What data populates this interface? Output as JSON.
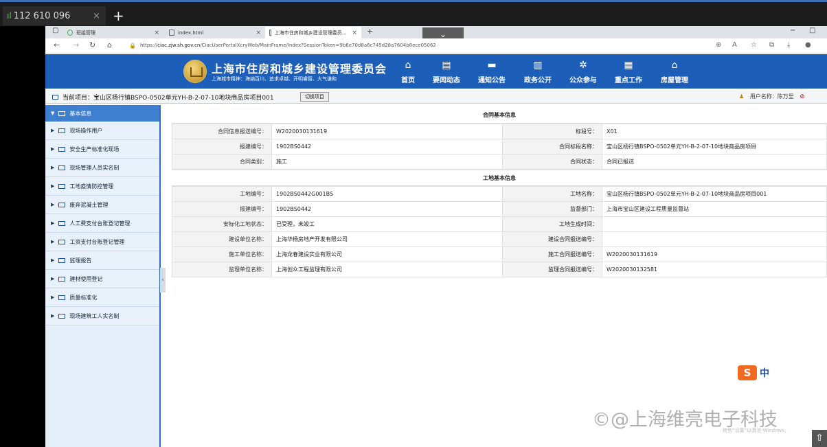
{
  "outer": {
    "tab_label": "112 610 096",
    "tab_signal": "ıl",
    "close": "×",
    "plus": "+"
  },
  "browser": {
    "tabs": [
      {
        "label": "班组管理",
        "close": "×"
      },
      {
        "label": "index.html",
        "close": "×"
      },
      {
        "label": "上海市住房和城乡建设管理委员...",
        "close": "×"
      }
    ],
    "new_tab": "+",
    "window_controls": {
      "minimize": "−",
      "maximize": "□"
    },
    "dropdown": "⌄",
    "nav": {
      "back": "←",
      "forward": "→",
      "reload": "↻",
      "home": "⌂"
    },
    "url_prefix": "https://",
    "url_domain": "ciac.zjw.sh.gov.cn",
    "url_path": "/CiacUserPortalXcryWeb/MainFrame/Index?SessionToken=9b6e70d8a6c745d28a7604b8ece05062"
  },
  "site": {
    "title": "上海市住房和城乡建设管理委员会",
    "subtitle": "上海城市精神：海纳百川、追求卓越、开明睿智、大气谦和",
    "nav": [
      {
        "label": "首页",
        "icon": "⌂"
      },
      {
        "label": "要闻动态",
        "icon": "▤"
      },
      {
        "label": "通知公告",
        "icon": "▬"
      },
      {
        "label": "政务公开",
        "icon": "▥"
      },
      {
        "label": "公众参与",
        "icon": "✲"
      },
      {
        "label": "重点工作",
        "icon": "▦"
      },
      {
        "label": "房屋管理",
        "icon": "⌂"
      }
    ]
  },
  "project": {
    "label": "当前项目：宝山区杨行镇BSPO-0502单元YH-B-2-07-10地块商品房项目001",
    "switch_button": "切换项目",
    "user_label": "用户名称：陈万里",
    "user_icon": "♟",
    "logout_icon": "⊘"
  },
  "sidebar": {
    "header": "基本信息",
    "items": [
      "现场操作用户",
      "安全生产标准化现场",
      "现场管理人员实名制",
      "工地疫情防控管理",
      "废弃泥凝土管理",
      "人工费支付台账登记管理",
      "工资支付台账登记管理",
      "监理报告",
      "建材使用登记",
      "质量标准化",
      "现场建筑工人实名制"
    ],
    "collapse": "‹"
  },
  "contract": {
    "title": "合同基本信息",
    "rows": [
      {
        "k1": "合同信息报送编号：",
        "v1": "W2020030131619",
        "k2": "标段号：",
        "v2": "X01"
      },
      {
        "k1": "报建编号：",
        "v1": "1902BS0442",
        "k2": "合同标段名称：",
        "v2": "宝山区杨行镇BSPO-0502单元YH-B-2-07-10地块商品房项目"
      },
      {
        "k1": "合同类别：",
        "v1": "施工",
        "k2": "合同状态：",
        "v2": "合同已报送"
      }
    ]
  },
  "site_info": {
    "title": "工地基本信息",
    "rows": [
      {
        "k1": "工地编号：",
        "v1": "1902BS0442G001BS",
        "k2": "工地名称：",
        "v2": "宝山区杨行镇BSPO-0502单元YH-B-2-07-10地块商品房项目001"
      },
      {
        "k1": "报建编号：",
        "v1": "1902BS0442",
        "k2": "监督部门：",
        "v2": "上海市宝山区建设工程质量监督站"
      },
      {
        "k1": "安标化工地状态：",
        "v1": "已受理，未竣工",
        "k2": "工地生成时间：",
        "v2": ""
      },
      {
        "k1": "建设单位名称：",
        "v1": "上海华杨房地产开发有限公司",
        "k2": "建设合同报送编号：",
        "v2": ""
      },
      {
        "k1": "施工单位名称：",
        "v1": "上海龙春建设实业有限公司",
        "k2": "施工合同报送编号：",
        "v2": "W2020030131619"
      },
      {
        "k1": "监理单位名称：",
        "v1": "上海创众工程监理有限公司",
        "k2": "监理合同报送编号：",
        "v2": "W2020030132581"
      }
    ]
  },
  "overlay": {
    "ime_logo": "S",
    "ime_lang": "中",
    "watermark": "©@上海维亮电子科技",
    "activate": "转到“设置”以激活 Windows。",
    "scroll_top": "⇧"
  }
}
